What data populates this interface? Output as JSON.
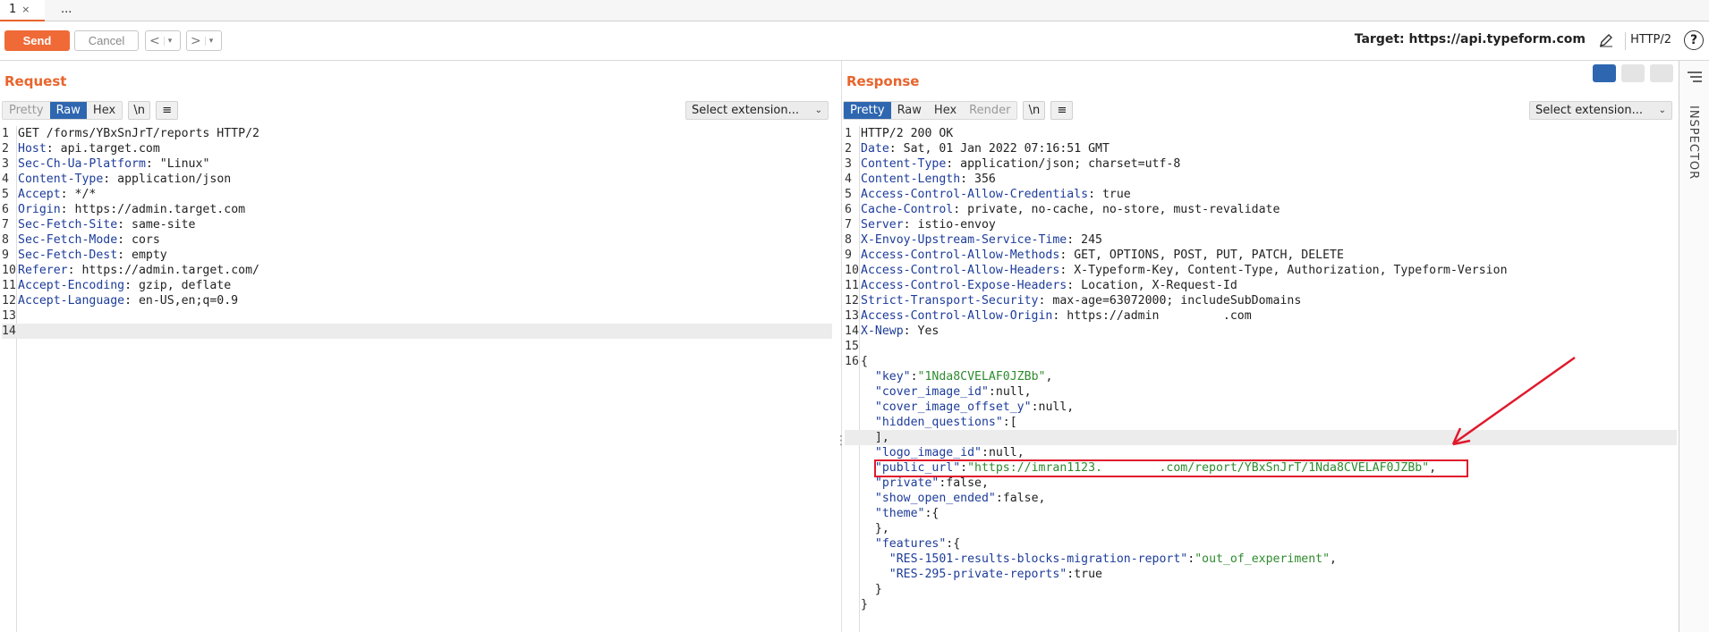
{
  "tabs": {
    "active_label": "1",
    "close": "×",
    "more": "..."
  },
  "toolbar": {
    "send_label": "Send",
    "cancel_label": "Cancel",
    "back": "<",
    "forward": ">",
    "dropdown": "▾",
    "target_label": "Target: https://api.typeform.com",
    "protocol": "HTTP/2",
    "help": "?"
  },
  "request": {
    "title": "Request",
    "modes": [
      "Pretty",
      "Raw",
      "Hex"
    ],
    "newline_btn": "\\n",
    "select_extension": "Select extension...",
    "lines": [
      {
        "n": "1",
        "k": "",
        "v": "GET /forms/YBxSnJrT/reports HTTP/2"
      },
      {
        "n": "2",
        "k": "Host",
        "v": ": api.target.com"
      },
      {
        "n": "3",
        "k": "Sec-Ch-Ua-Platform",
        "v": ": \"Linux\""
      },
      {
        "n": "4",
        "k": "Content-Type",
        "v": ": application/json"
      },
      {
        "n": "5",
        "k": "Accept",
        "v": ": */*"
      },
      {
        "n": "6",
        "k": "Origin",
        "v": ": https://admin.target.com"
      },
      {
        "n": "7",
        "k": "Sec-Fetch-Site",
        "v": ": same-site"
      },
      {
        "n": "8",
        "k": "Sec-Fetch-Mode",
        "v": ": cors"
      },
      {
        "n": "9",
        "k": "Sec-Fetch-Dest",
        "v": ": empty"
      },
      {
        "n": "10",
        "k": "Referer",
        "v": ": https://admin.target.com/"
      },
      {
        "n": "11",
        "k": "Accept-Encoding",
        "v": ": gzip, deflate"
      },
      {
        "n": "12",
        "k": "Accept-Language",
        "v": ": en-US,en;q=0.9"
      },
      {
        "n": "13",
        "k": "",
        "v": ""
      },
      {
        "n": "14",
        "k": "",
        "v": ""
      }
    ]
  },
  "response": {
    "title": "Response",
    "modes": [
      "Pretty",
      "Raw",
      "Hex",
      "Render"
    ],
    "newline_btn": "\\n",
    "select_extension": "Select extension...",
    "lines": [
      {
        "n": "1",
        "k": "",
        "v": "HTTP/2 200 OK"
      },
      {
        "n": "2",
        "k": "Date",
        "v": ": Sat, 01 Jan 2022 07:16:51 GMT"
      },
      {
        "n": "3",
        "k": "Content-Type",
        "v": ": application/json; charset=utf-8"
      },
      {
        "n": "4",
        "k": "Content-Length",
        "v": ": 356"
      },
      {
        "n": "5",
        "k": "Access-Control-Allow-Credentials",
        "v": ": true"
      },
      {
        "n": "6",
        "k": "Cache-Control",
        "v": ": private, no-cache, no-store, must-revalidate"
      },
      {
        "n": "7",
        "k": "Server",
        "v": ": istio-envoy"
      },
      {
        "n": "8",
        "k": "X-Envoy-Upstream-Service-Time",
        "v": ": 245"
      },
      {
        "n": "9",
        "k": "Access-Control-Allow-Methods",
        "v": ": GET, OPTIONS, POST, PUT, PATCH, DELETE"
      },
      {
        "n": "10",
        "k": "Access-Control-Allow-Headers",
        "v": ": X-Typeform-Key, Content-Type, Authorization, Typeform-Version"
      },
      {
        "n": "11",
        "k": "Access-Control-Expose-Headers",
        "v": ": Location, X-Request-Id"
      },
      {
        "n": "12",
        "k": "Strict-Transport-Security",
        "v": ": max-age=63072000; includeSubDomains"
      },
      {
        "n": "13",
        "k": "Access-Control-Allow-Origin",
        "v": ": https://admin         .com"
      },
      {
        "n": "14",
        "k": "X-Newp",
        "v": ": Yes"
      },
      {
        "n": "15",
        "k": "",
        "v": ""
      },
      {
        "n": "16",
        "k": "",
        "v": "{"
      }
    ],
    "json_lines": [
      {
        "k": "  \"key\"",
        "sep": ":",
        "s": "\"1Nda8CVELAF0JZBb\"",
        "t": ","
      },
      {
        "k": "  \"cover_image_id\"",
        "sep": ":",
        "s": "",
        "t": "null,"
      },
      {
        "k": "  \"cover_image_offset_y\"",
        "sep": ":",
        "s": "",
        "t": "null,"
      },
      {
        "k": "  \"hidden_questions\"",
        "sep": ":",
        "s": "",
        "t": "["
      },
      {
        "k": "",
        "sep": "",
        "s": "",
        "t": "  ],"
      },
      {
        "k": "  \"logo_image_id\"",
        "sep": ":",
        "s": "",
        "t": "null,"
      },
      {
        "k": "  \"public_url\"",
        "sep": ":",
        "s": "\"https://imran1123.        .com/report/YBxSnJrT/1Nda8CVELAF0JZBb\"",
        "t": ","
      },
      {
        "k": "  \"private\"",
        "sep": ":",
        "s": "",
        "t": "false,"
      },
      {
        "k": "  \"show_open_ended\"",
        "sep": ":",
        "s": "",
        "t": "false,"
      },
      {
        "k": "  \"theme\"",
        "sep": ":",
        "s": "",
        "t": "{"
      },
      {
        "k": "",
        "sep": "",
        "s": "",
        "t": "  },"
      },
      {
        "k": "  \"features\"",
        "sep": ":",
        "s": "",
        "t": "{"
      },
      {
        "k": "    \"RES-1501-results-blocks-migration-report\"",
        "sep": ":",
        "s": "\"out_of_experiment\"",
        "t": ","
      },
      {
        "k": "    \"RES-295-private-reports\"",
        "sep": ":",
        "s": "",
        "t": "true"
      },
      {
        "k": "",
        "sep": "",
        "s": "",
        "t": "  }"
      },
      {
        "k": "",
        "sep": "",
        "s": "",
        "t": "}"
      }
    ]
  },
  "inspector": {
    "label": "INSPECTOR"
  },
  "colors": {
    "accent": "#e8642c",
    "selected": "#2e67b0",
    "annotation": "#e0192c"
  }
}
